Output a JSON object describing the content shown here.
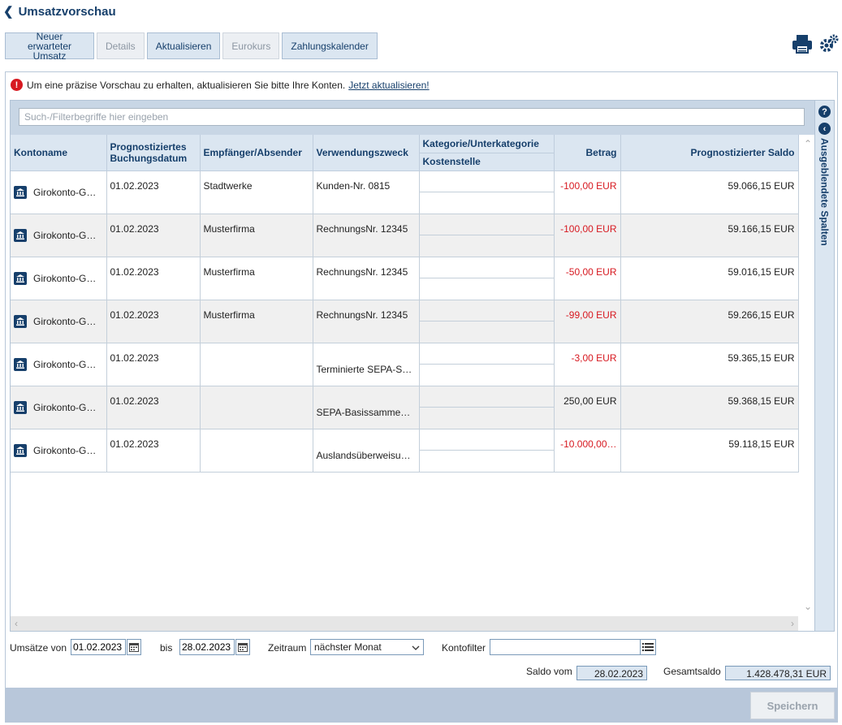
{
  "page": {
    "title": "Umsatzvorschau"
  },
  "toolbar": {
    "new_expected": "Neuer erwarteter Umsatz",
    "details": "Details",
    "refresh": "Aktualisieren",
    "eurokurs": "Eurokurs",
    "payment_calendar": "Zahlungskalender"
  },
  "notice": {
    "text": "Um eine präzise Vorschau zu erhalten, aktualisieren Sie bitte Ihre Konten.",
    "link": "Jetzt aktualisieren!"
  },
  "search": {
    "placeholder": "Such-/Filterbegriffe hier eingeben"
  },
  "hidden_columns_label": "Ausgeblendete Spalten",
  "columns": {
    "account": "Kontoname",
    "date": "Prognostiziertes Buchungsdatum",
    "party": "Empfänger/Absender",
    "purpose": "Verwendungszweck",
    "category": "Kategorie/Unterkategorie",
    "cost_center": "Kostenstelle",
    "amount": "Betrag",
    "balance": "Prognostizierter Saldo"
  },
  "rows": [
    {
      "account": "Girokonto-G…",
      "date": "01.02.2023",
      "party": "Stadtwerke",
      "purpose": "Kunden-Nr. 0815",
      "amount": "-100,00 EUR",
      "balance": "59.066,15 EUR"
    },
    {
      "account": "Girokonto-G…",
      "date": "01.02.2023",
      "party": "Musterfirma",
      "purpose": "RechnungsNr. 12345",
      "amount": "-100,00 EUR",
      "balance": "59.166,15 EUR"
    },
    {
      "account": "Girokonto-G…",
      "date": "01.02.2023",
      "party": "Musterfirma",
      "purpose": "RechnungsNr. 12345",
      "amount": "-50,00 EUR",
      "balance": "59.016,15 EUR"
    },
    {
      "account": "Girokonto-G…",
      "date": "01.02.2023",
      "party": "Musterfirma",
      "purpose": "RechnungsNr. 12345",
      "amount": "-99,00 EUR",
      "balance": "59.266,15 EUR"
    },
    {
      "account": "Girokonto-G…",
      "date": "01.02.2023",
      "party": "",
      "purpose": "Terminierte SEPA-S…",
      "amount": "-3,00 EUR",
      "balance": "59.365,15 EUR"
    },
    {
      "account": "Girokonto-G…",
      "date": "01.02.2023",
      "party": "",
      "purpose": "SEPA-Basissamme…",
      "amount": "250,00 EUR",
      "balance": "59.368,15 EUR"
    },
    {
      "account": "Girokonto-G…",
      "date": "01.02.2023",
      "party": "",
      "purpose": "Auslandsüberweisu…",
      "amount": "-10.000,00…",
      "balance": "59.118,15 EUR"
    }
  ],
  "filters": {
    "from_label": "Umsätze von",
    "from_value": "01.02.2023",
    "to_label": "bis",
    "to_value": "28.02.2023",
    "period_label": "Zeitraum",
    "period_value": "nächster Monat",
    "account_filter_label": "Kontofilter",
    "account_filter_value": ""
  },
  "summary": {
    "saldo_label": "Saldo vom",
    "saldo_date": "28.02.2023",
    "total_label": "Gesamtsaldo",
    "total_value": "1.428.478,31 EUR"
  },
  "footer": {
    "save": "Speichern"
  },
  "colors": {
    "accent": "#163f6b",
    "negative": "#d71920"
  }
}
